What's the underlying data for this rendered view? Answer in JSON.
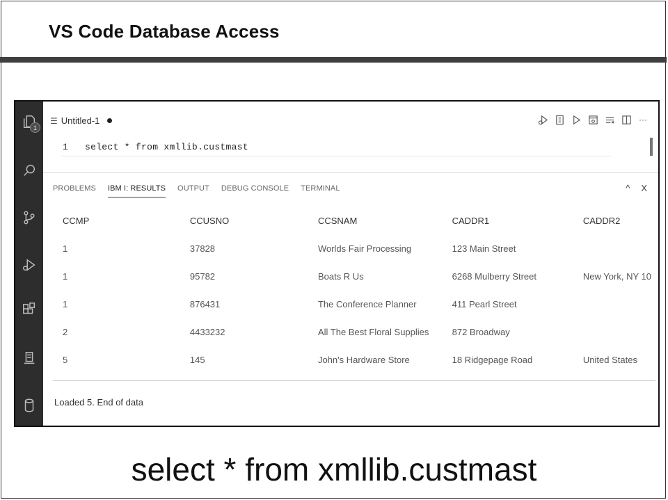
{
  "slide": {
    "title": "VS Code Database Access",
    "caption": "select * from xmllib.custmast"
  },
  "activity_bar": {
    "icons": [
      "files-icon",
      "search-icon",
      "source-control-icon",
      "run-debug-icon",
      "extensions-icon",
      "ibmi-icon",
      "database-icon"
    ],
    "explorer_badge": "1"
  },
  "editor": {
    "tab_label": "Untitled-1",
    "line_number": "1",
    "code": "select * from xmllib.custmast",
    "toolbar_icons": [
      "run-debug-icon",
      "notebook-icon",
      "run-icon",
      "open-changes-icon",
      "clear-icon",
      "split-editor-icon",
      "more-icon"
    ],
    "more_label": "···"
  },
  "panel": {
    "tabs": [
      "PROBLEMS",
      "IBM I: RESULTS",
      "OUTPUT",
      "DEBUG CONSOLE",
      "TERMINAL"
    ],
    "active_tab": "IBM I: RESULTS",
    "controls": {
      "collapse": "^",
      "close": "X"
    },
    "columns": [
      "CCMP",
      "CCUSNO",
      "CCSNAM",
      "CADDR1",
      "CADDR2"
    ],
    "rows": [
      [
        "1",
        "37828",
        "Worlds Fair Processing",
        "123 Main Street",
        ""
      ],
      [
        "1",
        "95782",
        "Boats R Us",
        "6268 Mulberry Street",
        "New York, NY 10"
      ],
      [
        "1",
        "876431",
        "The Conference Planner",
        "411 Pearl Street",
        ""
      ],
      [
        "2",
        "4433232",
        "All The Best Floral Supplies",
        "872 Broadway",
        ""
      ],
      [
        "5",
        "145",
        "John's Hardware Store",
        "18 Ridgepage Road",
        "United States"
      ]
    ],
    "status": "Loaded 5. End of data"
  }
}
